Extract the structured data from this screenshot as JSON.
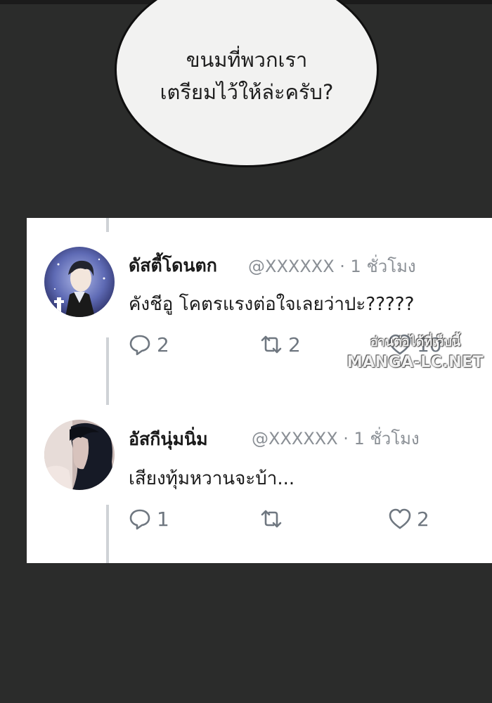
{
  "speech_bubble": {
    "line1": "ขนมที่พวกเรา",
    "line2": "เตรียมไว้ให้ล่ะครับ?"
  },
  "posts": [
    {
      "display_name": "ดัสตี้โดนตก",
      "handle": "@XXXXXX",
      "time": "· 1 ชั่วโมง",
      "text": "คังชีอู โคตรแรงต่อใจเลยว่าปะ?????",
      "replies": "2",
      "retweets": "2",
      "likes": "10"
    },
    {
      "display_name": "อัสกีนุ่มนิ่ม",
      "handle": "@XXXXXX",
      "time": "· 1 ชั่วโมง",
      "text": "เสียงทุ้มหวานจะบ้า...",
      "replies": "1",
      "retweets": "",
      "likes": "2"
    }
  ],
  "watermark": {
    "line1": "อ่านต่อได้ที่เว็บนี้",
    "line2": "MANGA-LC.NET"
  },
  "colors": {
    "background": "#2b2c2b",
    "card": "#ffffff",
    "icon_gray": "#6f7780",
    "meta_gray": "#8a8f95"
  }
}
